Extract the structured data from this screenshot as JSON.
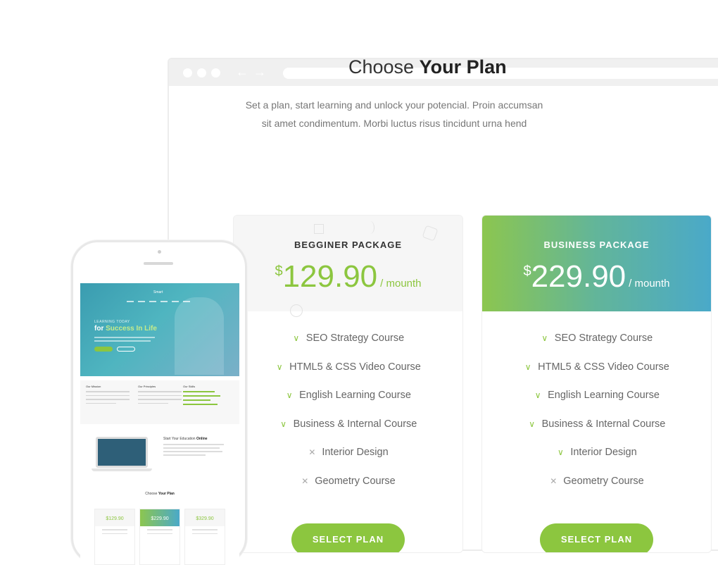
{
  "page": {
    "heading_light": "Choose",
    "heading_bold": "Your Plan",
    "subtext_line1": "Set a plan, start learning and unlock your potencial. Proin accumsan",
    "subtext_line2": "sit amet condimentum. Morbi luctus risus tincidunt urna hend"
  },
  "plans": [
    {
      "name": "BEGGINER PACKAGE",
      "currency": "$",
      "price": "129.90",
      "period": "/ mounth",
      "features": [
        {
          "label": "SEO Strategy Course",
          "included": true
        },
        {
          "label": "HTML5 & CSS Video Course",
          "included": true
        },
        {
          "label": "English Learning Course",
          "included": true
        },
        {
          "label": "Business & Internal Course",
          "included": true
        },
        {
          "label": "Interior Design",
          "included": false
        },
        {
          "label": "Geometry Course",
          "included": false
        }
      ],
      "button": "SELECT PLAN"
    },
    {
      "name": "BUSINESS PACKAGE",
      "currency": "$",
      "price": "229.90",
      "period": "/ mounth",
      "features": [
        {
          "label": "SEO Strategy Course",
          "included": true
        },
        {
          "label": "HTML5 & CSS Video Course",
          "included": true
        },
        {
          "label": "English Learning Course",
          "included": true
        },
        {
          "label": "Business & Internal Course",
          "included": true
        },
        {
          "label": "Interior Design",
          "included": true
        },
        {
          "label": "Geometry Course",
          "included": false
        }
      ],
      "button": "SELECT PLAN"
    }
  ],
  "icons": {
    "check": "check-icon",
    "cross": "cross-icon"
  },
  "colors": {
    "accent_green": "#8cc63f",
    "gradient_start": "#8cc64f",
    "gradient_end": "#4aa9c9"
  },
  "phone": {
    "hero_tagline": "LEARNING TODAY",
    "hero_title_prefix": "for ",
    "hero_title_highlight": "Success In Life",
    "logo": "Smart",
    "col_titles": [
      "Our Mission",
      "Our Principles",
      "Our Skills"
    ],
    "edu_title_light": "Start Your Education",
    "edu_title_bold": "Online",
    "plan_title_light": "Choose",
    "plan_title_bold": "Your Plan",
    "mini_prices": [
      "$129.90",
      "$229.90",
      "$329.90"
    ]
  }
}
